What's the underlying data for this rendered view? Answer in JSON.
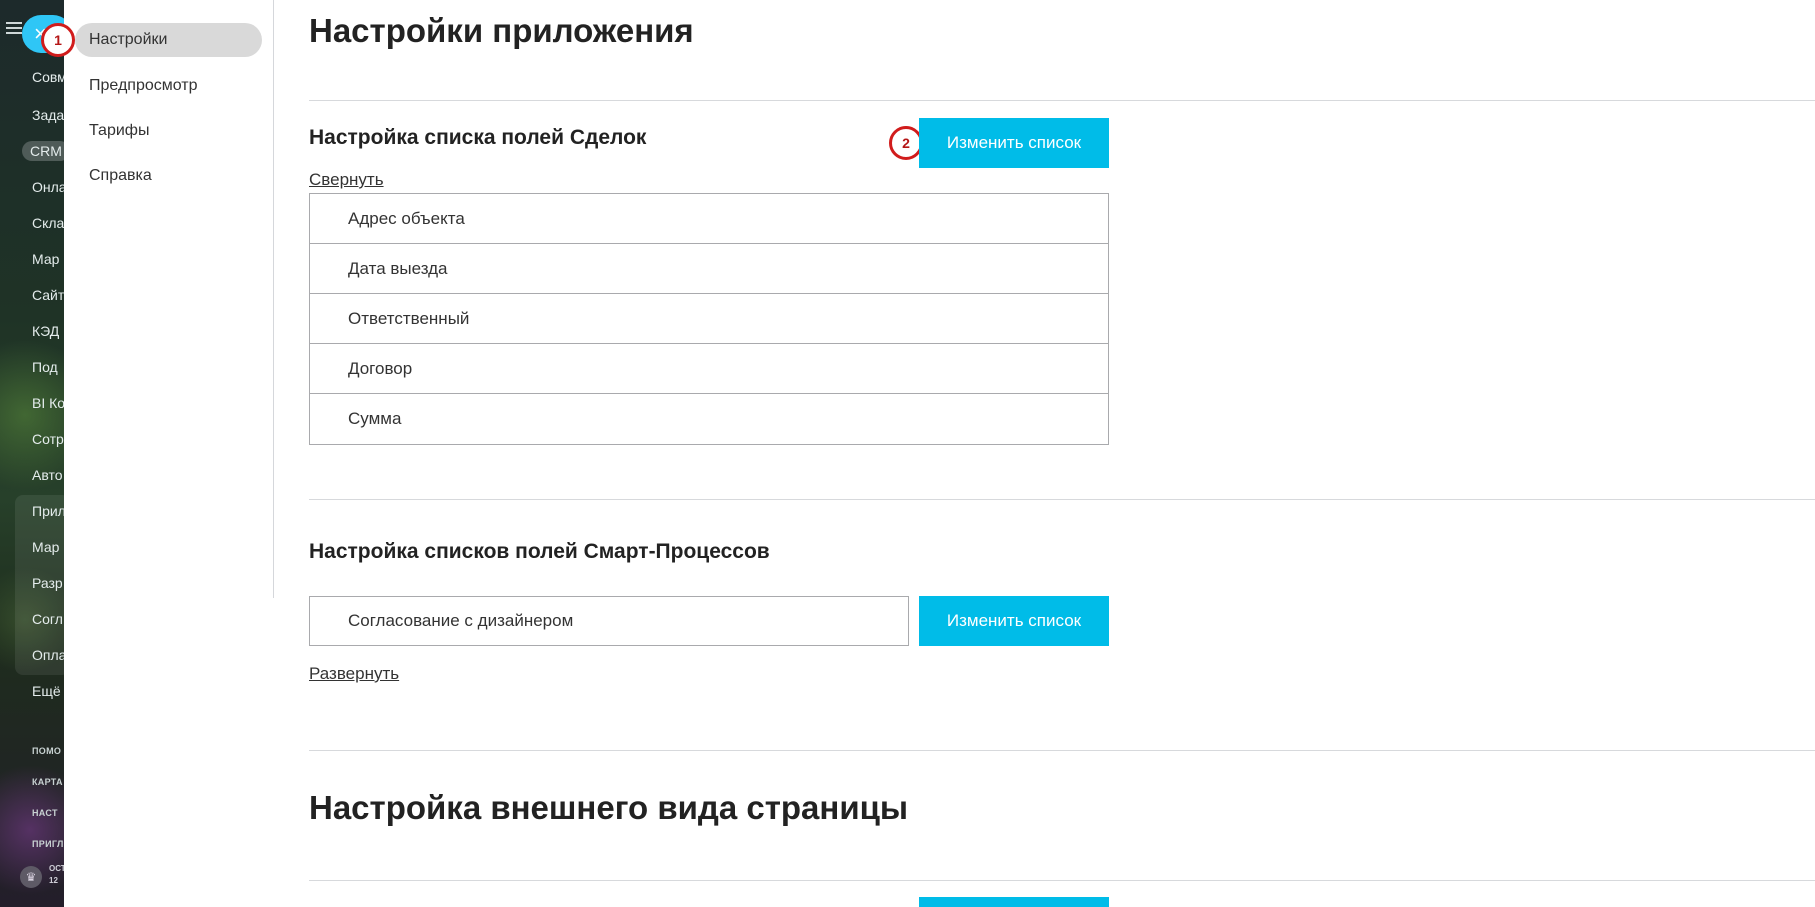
{
  "background_sidebar": {
    "items": [
      {
        "label": "Совм"
      },
      {
        "label": "Зада"
      },
      {
        "label": "CRM"
      },
      {
        "label": "Онла"
      },
      {
        "label": "Скла"
      },
      {
        "label": "Мар"
      },
      {
        "label": "Сайт"
      },
      {
        "label": "КЭД"
      },
      {
        "label": "Под"
      },
      {
        "label": "BI Ко"
      },
      {
        "label": "Сотр"
      },
      {
        "label": "Авто"
      },
      {
        "label": "Прил"
      },
      {
        "label": "Мар"
      },
      {
        "label": "Разр"
      },
      {
        "label": "Согл"
      },
      {
        "label": "Опла"
      },
      {
        "label": "Ещё"
      }
    ],
    "footer_items": [
      {
        "label": "ПОМО"
      },
      {
        "label": "КАРТА"
      },
      {
        "label": "НАСТ"
      },
      {
        "label": "ПРИГЛ"
      }
    ],
    "plan_line1": "ОСТ",
    "plan_line2": "12"
  },
  "app_nav": {
    "items": [
      {
        "label": "Настройки"
      },
      {
        "label": "Предпросмотр"
      },
      {
        "label": "Тарифы"
      },
      {
        "label": "Справка"
      }
    ]
  },
  "annotations": {
    "badge1": "1",
    "badge2": "2"
  },
  "page": {
    "title": "Настройки приложения",
    "deals_section": {
      "title": "Настройка списка полей Сделок",
      "edit_button": "Изменить список",
      "toggle_link": "Свернуть",
      "fields": [
        "Адрес объекта",
        "Дата выезда",
        "Ответственный",
        "Договор",
        "Сумма"
      ]
    },
    "smart_section": {
      "title": "Настройка списков полей Смарт-Процессов",
      "field": "Согласование с дизайнером",
      "edit_button": "Изменить список",
      "toggle_link": "Развернуть"
    },
    "appearance_title": "Настройка внешнего вида страницы"
  },
  "colors": {
    "accent": "#00bce8",
    "annotation": "#d11c1c",
    "nav_active": "#d9d9d9"
  }
}
